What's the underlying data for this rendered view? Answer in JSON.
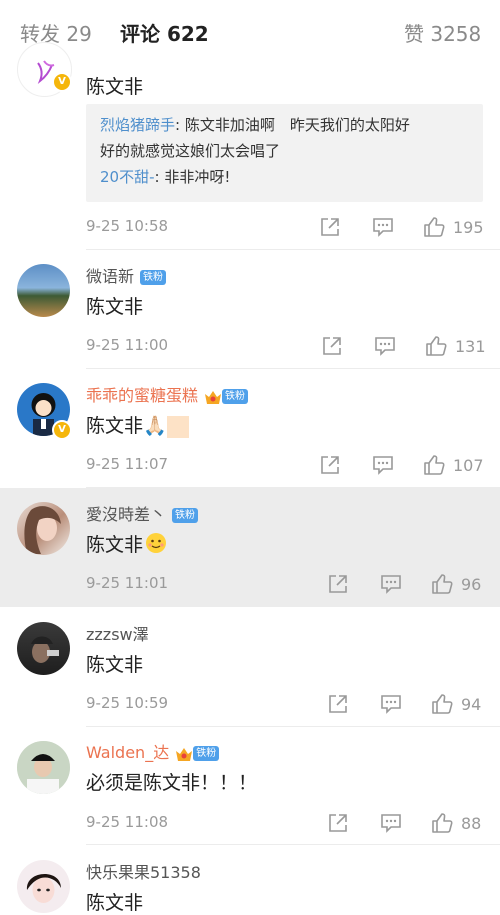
{
  "tabs": {
    "repost": {
      "label": "转发",
      "count": "29"
    },
    "comment": {
      "label": "评论",
      "count": "622"
    },
    "like": {
      "label": "赞",
      "count": "3258"
    }
  },
  "comments": [
    {
      "name": "陈文非",
      "replies": [
        {
          "name": "烈焰猪蹄手",
          "text": ": 陈文非加油啊　昨天我们的太阳好"
        },
        {
          "name": "",
          "text": "好的就感觉这娘们太会唱了"
        },
        {
          "name": "20不甜-",
          "text": ": 非非冲呀!"
        }
      ],
      "time": "9-25 10:58",
      "likes": "195"
    },
    {
      "name": "微语新",
      "badge": "铁粉",
      "text": "陈文非",
      "time": "9-25 11:00",
      "likes": "131"
    },
    {
      "name": "乖乖的蜜糖蛋糕",
      "badge": "铁粉",
      "text": "陈文非🙏🏻",
      "time": "9-25 11:07",
      "likes": "107"
    },
    {
      "name": "愛沒時差丶",
      "badge": "铁粉",
      "text": "陈文非",
      "time": "9-25 11:01",
      "likes": "96"
    },
    {
      "name": "zzzsw澤",
      "text": "陈文非",
      "time": "9-25 10:59",
      "likes": "94"
    },
    {
      "name": "Walden_达",
      "badge": "铁粉",
      "text": "必须是陈文非！！！",
      "time": "9-25 11:08",
      "likes": "88"
    },
    {
      "name": "快乐果果51358",
      "text": "陈文非"
    }
  ],
  "colors": {
    "accent": "#eb7350",
    "link": "#4f8fcc",
    "fan_badge": "#4fa0ea",
    "highlight_row": "#ececec"
  }
}
